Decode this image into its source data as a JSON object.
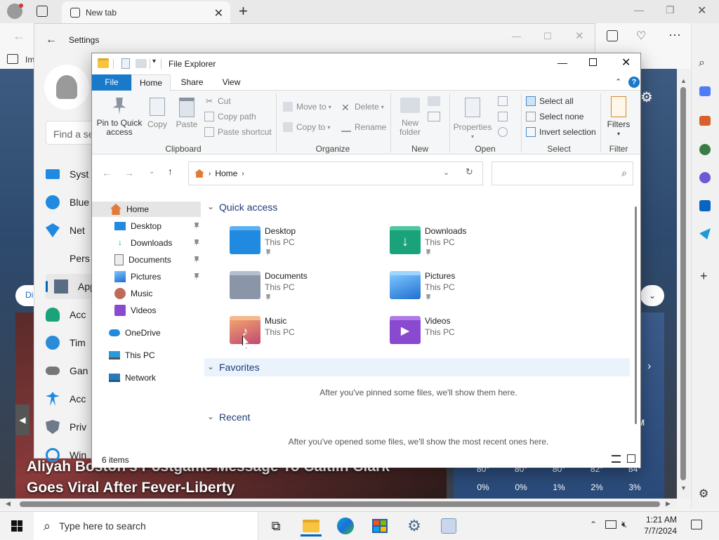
{
  "browser": {
    "tab_title": "New tab",
    "favorites_fragment": "Im"
  },
  "settings": {
    "title": "Settings",
    "search_placeholder": "Find a se",
    "nav_items": [
      {
        "label": "Syst",
        "icon": "system-icon"
      },
      {
        "label": "Blue",
        "icon": "bluetooth-icon"
      },
      {
        "label": "Net",
        "icon": "network-icon"
      },
      {
        "label": "Pers",
        "icon": "personalization-icon"
      },
      {
        "label": "App",
        "icon": "apps-icon"
      },
      {
        "label": "Acc",
        "icon": "accounts-icon"
      },
      {
        "label": "Tim",
        "icon": "time-icon"
      },
      {
        "label": "Gan",
        "icon": "gaming-icon"
      },
      {
        "label": "Acc",
        "icon": "accessibility-icon"
      },
      {
        "label": "Priv",
        "icon": "privacy-icon"
      },
      {
        "label": "Win",
        "icon": "windows-update-icon"
      }
    ]
  },
  "news": {
    "headline_line1": "Aliyah Boston's Postgame Message To Caitlin Clark",
    "headline_line2": "Goes Viral After Fever-Liberty",
    "side_label": "Di",
    "weather": [
      {
        "temp": "80°",
        "precip": "0%"
      },
      {
        "temp": "80°",
        "precip": "0%"
      },
      {
        "temp": "80°",
        "precip": "1%"
      },
      {
        "temp": "82°",
        "precip": "2%"
      },
      {
        "temp": "84°",
        "precip": "3%"
      }
    ],
    "weather_side": "M"
  },
  "explorer": {
    "title": "File Explorer",
    "tabs": {
      "file": "File",
      "home": "Home",
      "share": "Share",
      "view": "View"
    },
    "ribbon": {
      "pin": "Pin to Quick access",
      "pin_line1": "Pin to Quick",
      "pin_line2": "access",
      "copy": "Copy",
      "paste": "Paste",
      "cut": "Cut",
      "copy_path": "Copy path",
      "paste_shortcut": "Paste shortcut",
      "clipboard": "Clipboard",
      "move_to": "Move to",
      "copy_to": "Copy to",
      "delete": "Delete",
      "rename": "Rename",
      "organize": "Organize",
      "new_folder_line1": "New",
      "new_folder_line2": "folder",
      "new": "New",
      "properties": "Properties",
      "open": "Open",
      "select_all": "Select all",
      "select_none": "Select none",
      "invert_selection": "Invert selection",
      "select": "Select",
      "filters": "Filters",
      "filter": "Filter"
    },
    "address": {
      "crumb": "Home"
    },
    "nav": {
      "home": "Home",
      "desktop": "Desktop",
      "downloads": "Downloads",
      "documents": "Documents",
      "pictures": "Pictures",
      "music": "Music",
      "videos": "Videos",
      "onedrive": "OneDrive",
      "thispc": "This PC",
      "network": "Network"
    },
    "quick_access": {
      "header": "Quick access",
      "items": [
        {
          "name": "Desktop",
          "location": "This PC"
        },
        {
          "name": "Downloads",
          "location": "This PC"
        },
        {
          "name": "Documents",
          "location": "This PC"
        },
        {
          "name": "Pictures",
          "location": "This PC"
        },
        {
          "name": "Music",
          "location": "This PC"
        },
        {
          "name": "Videos",
          "location": "This PC"
        }
      ]
    },
    "favorites": {
      "header": "Favorites",
      "empty": "After you've pinned some files, we'll show them here."
    },
    "recent": {
      "header": "Recent",
      "empty": "After you've opened some files, we'll show the most recent ones here."
    },
    "status": "6 items"
  },
  "taskbar": {
    "search_placeholder": "Type here to search",
    "time": "1:21 AM",
    "date": "7/7/2024"
  },
  "colors": {
    "accent": "#0067c0",
    "file_tab": "#1979ca",
    "folder_yellow": "#f8c33f",
    "section_header": "#1f3c7a"
  }
}
